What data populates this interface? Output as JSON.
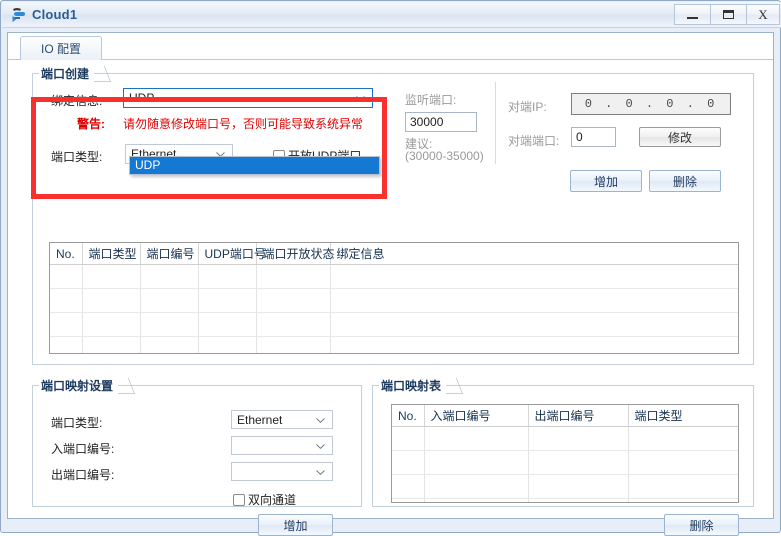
{
  "window": {
    "title": "Cloud1",
    "icon": "cloud-arrow-icon",
    "minimize_label": "–",
    "maximize_label": "▭",
    "close_label": "X"
  },
  "tabs": [
    {
      "label": "IO 配置",
      "active": true
    }
  ],
  "port_create": {
    "group_title": "端口创建",
    "binding_info_label": "绑定信息:",
    "binding_info_value": "UDP",
    "binding_info_options": [
      "UDP"
    ],
    "warning_label": "警告:",
    "warning_text": "请勿随意修改端口号，否则可能导致系统异常",
    "port_type_label": "端口类型:",
    "port_type_value": "Ethernet",
    "open_udp_checkbox_label": "开放UDP端口",
    "open_udp_checked": false,
    "listen_port_label": "监听端口:",
    "listen_port_value": "30000",
    "suggest_label": "建议:",
    "suggest_range": "(30000-35000)",
    "peer_ip_label": "对端IP:",
    "peer_ip_value": "0 . 0 . 0 . 0",
    "peer_port_label": "对端端口:",
    "peer_port_value": "0",
    "modify_button": "修改",
    "add_button": "增加",
    "delete_button": "删除"
  },
  "port_table": {
    "columns": [
      "No.",
      "端口类型",
      "端口编号",
      "UDP端口号",
      "端口开放状态",
      "绑定信息"
    ],
    "rows": [],
    "empty_row_count": 6
  },
  "mapping_settings": {
    "group_title": "端口映射设置",
    "port_type_label": "端口类型:",
    "port_type_value": "Ethernet",
    "in_port_label": "入端口编号:",
    "in_port_value": "",
    "out_port_label": "出端口编号:",
    "out_port_value": "",
    "bidirectional_label": "双向通道",
    "bidirectional_checked": false,
    "add_button": "增加"
  },
  "mapping_table": {
    "group_title": "端口映射表",
    "columns": [
      "No.",
      "入端口编号",
      "出端口编号",
      "端口类型"
    ],
    "rows": [],
    "empty_row_count": 4,
    "delete_button": "删除"
  },
  "annotation": {
    "highlight_color": "#f8312f",
    "highlight_name": "binding-info-highlight"
  }
}
